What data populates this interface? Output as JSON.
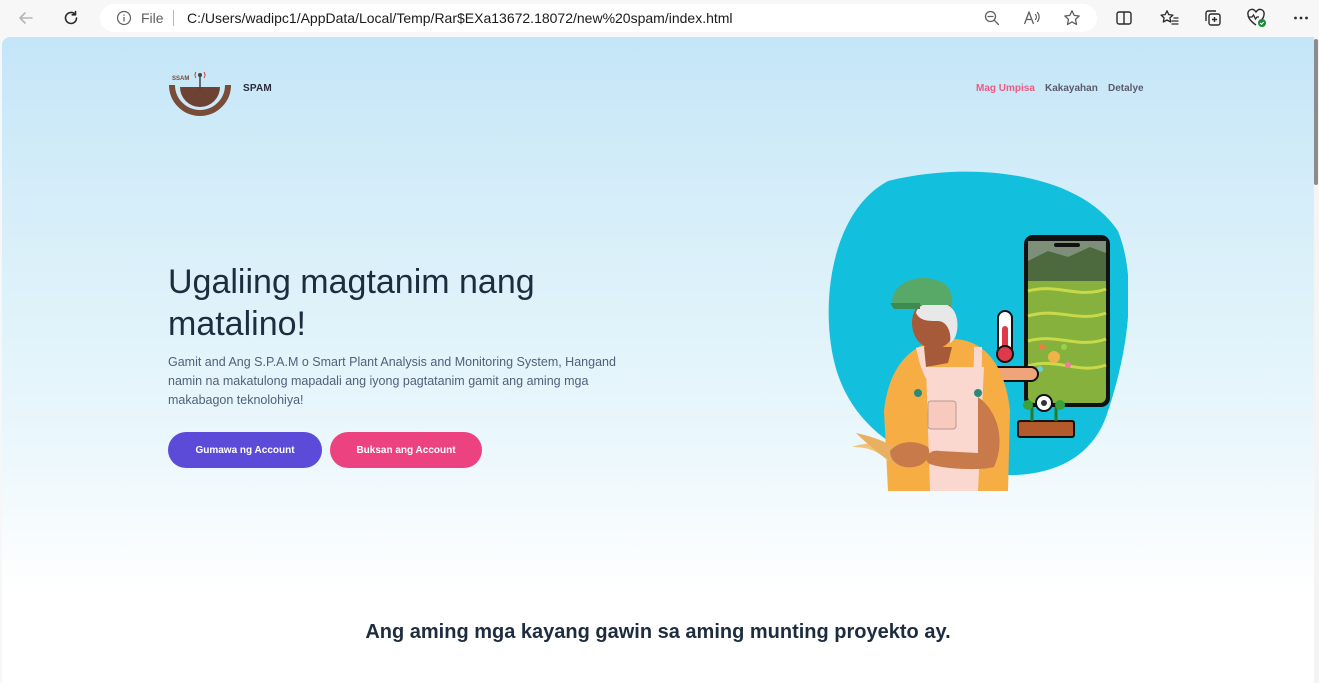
{
  "browser": {
    "file_label": "File",
    "url": "C:/Users/wadipc1/AppData/Local/Temp/Rar$EXa13672.18072/new%20spam/index.html"
  },
  "site": {
    "brand": "SPAM",
    "logo_text": "SSAM",
    "nav": [
      {
        "label": "Mag Umpisa",
        "active": true
      },
      {
        "label": "Kakayahan",
        "active": false
      },
      {
        "label": "Detalye",
        "active": false
      }
    ]
  },
  "hero": {
    "title": "Ugaliing magtanim nang matalino!",
    "description": "Gamit and Ang S.P.A.M o Smart Plant Analysis and Monitoring System, Hangand namin na makatulong mapadali ang iyong pagtatanim gamit ang aming mga makabagon teknolohiya!",
    "primary_button": "Gumawa ng Account",
    "secondary_button": "Buksan ang Account"
  },
  "section": {
    "title": "Ang aming mga kayang gawin sa aming munting proyekto ay."
  },
  "colors": {
    "accent_primary": "#5c4bd8",
    "accent_secondary": "#ec4280",
    "nav_active": "#ee5a82",
    "blob": "#12c0de"
  }
}
